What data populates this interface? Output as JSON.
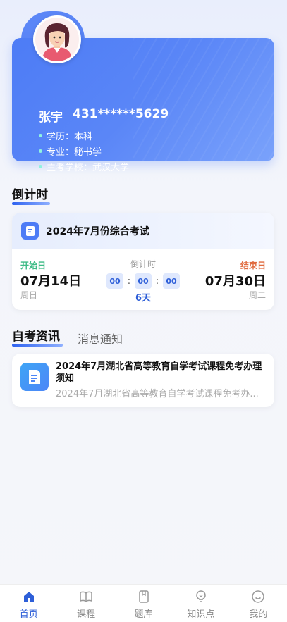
{
  "profile": {
    "name": "张宇",
    "id_number": "431******5629",
    "education_label": "学历：本科",
    "major_label": "专业：秘书学",
    "school_label": "主考学校：武汉大学",
    "avatar": "avatar-woman"
  },
  "countdown_section": {
    "title": "倒计时"
  },
  "countdown": {
    "exam_title": "2024年7月份综合考试",
    "exam_icon": "document-icon",
    "start_label": "开始日",
    "start_date": "07月14日",
    "start_weekday": "周日",
    "middle_label": "倒计时",
    "timer": [
      "00",
      "00",
      "00"
    ],
    "days_left": "6天",
    "end_label": "结束日",
    "end_date": "07月30日",
    "end_weekday": "周二"
  },
  "news_tabs": {
    "active": "自考资讯",
    "inactive": "消息通知"
  },
  "news": {
    "icon": "news-doc-icon",
    "title": "2024年7月湖北省高等教育自学考试课程免考办理须知",
    "preview": "2024年7月湖北省高等教育自学考试课程免考办..."
  },
  "nav": [
    {
      "label": "首页",
      "icon": "home-icon",
      "active": true
    },
    {
      "label": "课程",
      "icon": "book-icon",
      "active": false
    },
    {
      "label": "题库",
      "icon": "question-bank-icon",
      "active": false
    },
    {
      "label": "知识点",
      "icon": "bulb-icon",
      "active": false
    },
    {
      "label": "我的",
      "icon": "smile-icon",
      "active": false
    }
  ],
  "colors": {
    "accent": "#4d7cf6",
    "start_green": "#3dbb86",
    "end_orange": "#e06b3f"
  }
}
